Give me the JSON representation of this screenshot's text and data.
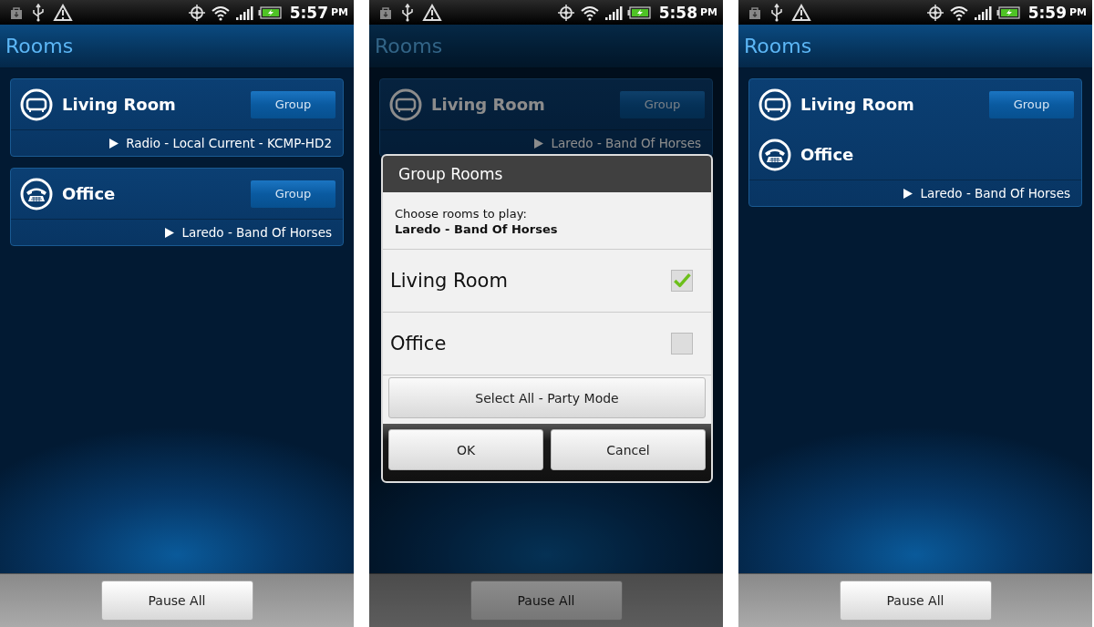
{
  "screens": [
    {
      "status_bar": {
        "time": "5:57",
        "meridiem": "PM"
      },
      "title": "Rooms",
      "zones": [
        {
          "rooms": [
            {
              "name": "Living Room",
              "kind": "sofa",
              "group_button": "Group"
            }
          ],
          "now_playing": "Radio - Local Current - KCMP-HD2"
        },
        {
          "rooms": [
            {
              "name": "Office",
              "kind": "phone",
              "group_button": "Group"
            }
          ],
          "now_playing": "Laredo - Band Of Horses"
        }
      ],
      "footer_button": "Pause All"
    },
    {
      "status_bar": {
        "time": "5:58",
        "meridiem": "PM"
      },
      "title": "Rooms",
      "zones": [
        {
          "rooms": [
            {
              "name": "Living Room",
              "kind": "sofa",
              "group_button": "Group"
            }
          ],
          "now_playing": "Laredo - Band Of Horses"
        }
      ],
      "footer_button": "Pause All",
      "dialog": {
        "title": "Group Rooms",
        "message": "Choose rooms to play:",
        "track": "Laredo - Band Of Horses",
        "options": [
          {
            "label": "Living Room",
            "checked": true
          },
          {
            "label": "Office",
            "checked": false
          }
        ],
        "select_all_button": "Select All - Party Mode",
        "buttons": [
          "OK",
          "Cancel"
        ]
      }
    },
    {
      "status_bar": {
        "time": "5:59",
        "meridiem": "PM"
      },
      "title": "Rooms",
      "zones": [
        {
          "rooms": [
            {
              "name": "Living Room",
              "kind": "sofa",
              "group_button": "Group"
            },
            {
              "name": "Office",
              "kind": "phone"
            }
          ],
          "now_playing": "Laredo - Band Of Horses"
        }
      ],
      "footer_button": "Pause All"
    }
  ]
}
